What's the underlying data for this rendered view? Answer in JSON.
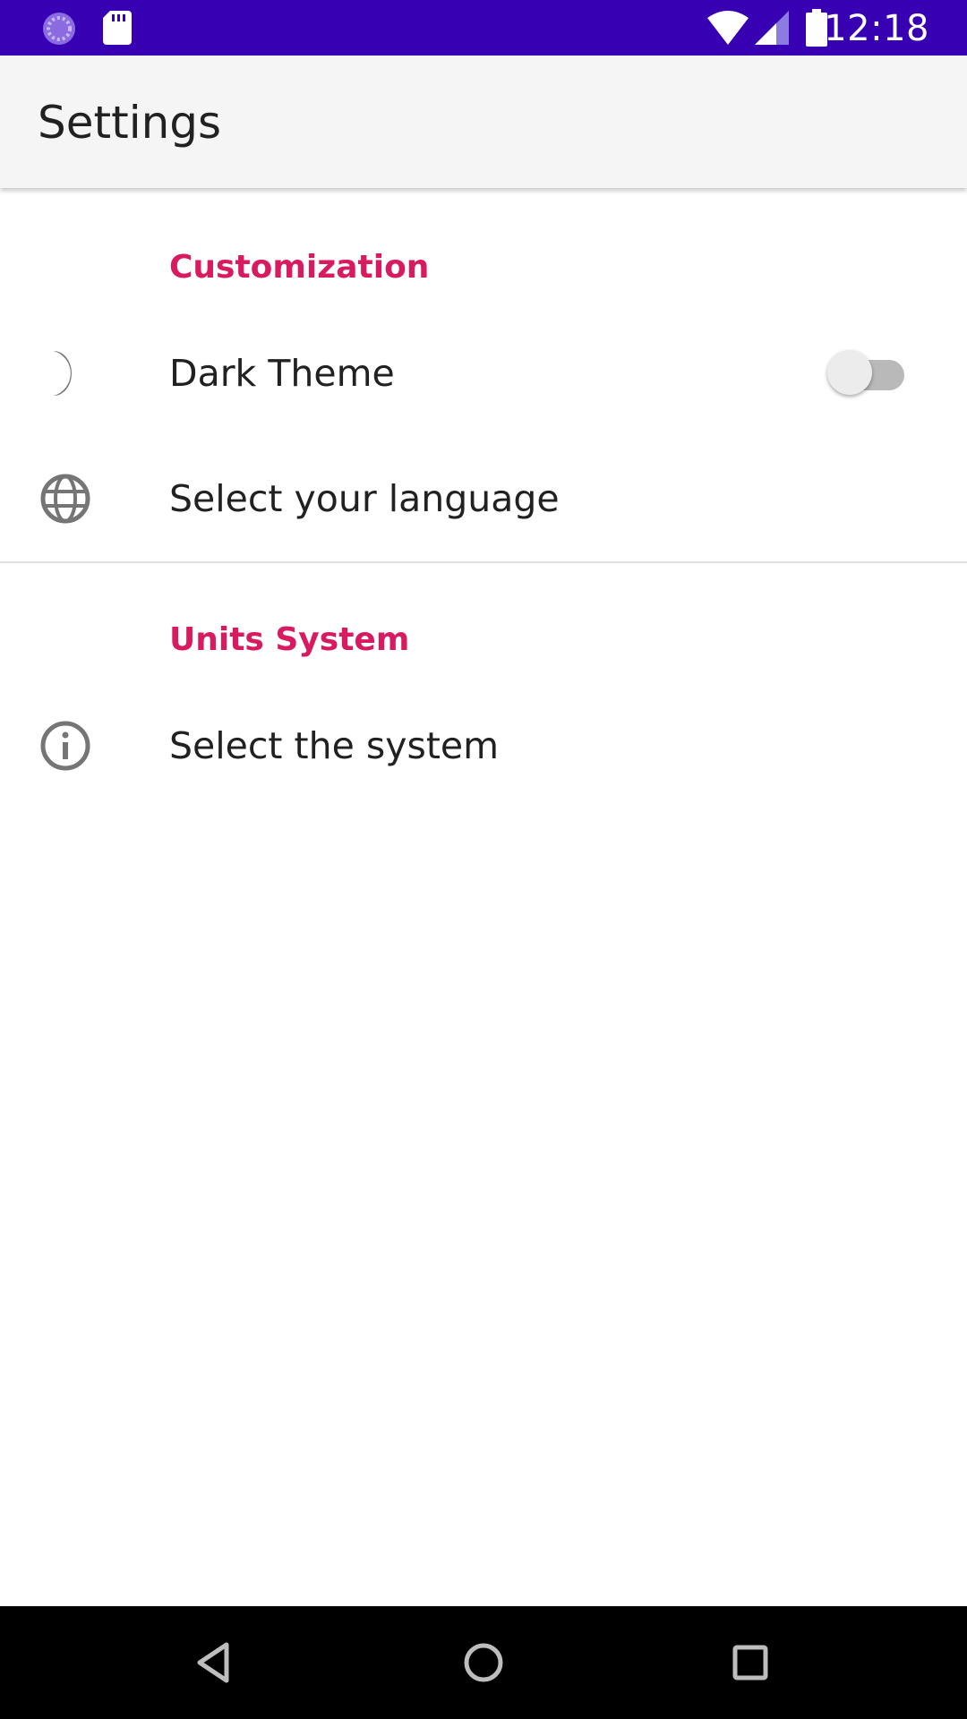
{
  "status_bar": {
    "time": "12:18",
    "left_icons": [
      "loading-icon",
      "sd-card-icon"
    ],
    "right_icons": [
      "wifi-icon",
      "signal-icon",
      "battery-icon"
    ],
    "background": "#3700b3"
  },
  "app_bar": {
    "title": "Settings"
  },
  "sections": [
    {
      "title": "Customization",
      "items": [
        {
          "title": "Dark Theme",
          "icon": "moon-icon",
          "switch_on": false
        },
        {
          "title": "Select your language",
          "icon": "globe-icon"
        }
      ]
    },
    {
      "title": "Units System",
      "items": [
        {
          "title": "Select the system",
          "icon": "info-icon"
        }
      ]
    }
  ],
  "navigation_bar": {
    "buttons": [
      "back-icon",
      "home-icon",
      "recents-icon"
    ]
  },
  "colors": {
    "accent": "#d81b60",
    "status_bar": "#3700b3",
    "app_bar": "#f5f5f5"
  }
}
